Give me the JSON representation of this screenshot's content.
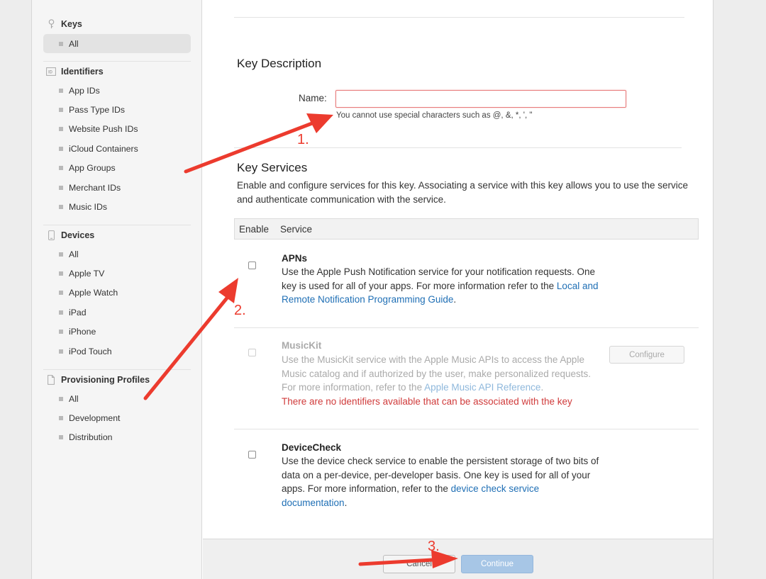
{
  "sidebar": {
    "sections": [
      {
        "icon": "key-icon",
        "title": "Keys",
        "items": [
          {
            "label": "All",
            "selected": true
          }
        ]
      },
      {
        "icon": "id-icon",
        "title": "Identifiers",
        "items": [
          {
            "label": "App IDs"
          },
          {
            "label": "Pass Type IDs"
          },
          {
            "label": "Website Push IDs"
          },
          {
            "label": "iCloud Containers"
          },
          {
            "label": "App Groups"
          },
          {
            "label": "Merchant IDs"
          },
          {
            "label": "Music IDs"
          }
        ]
      },
      {
        "icon": "device-icon",
        "title": "Devices",
        "items": [
          {
            "label": "All"
          },
          {
            "label": "Apple TV"
          },
          {
            "label": "Apple Watch"
          },
          {
            "label": "iPad"
          },
          {
            "label": "iPhone"
          },
          {
            "label": "iPod Touch"
          }
        ]
      },
      {
        "icon": "document-icon",
        "title": "Provisioning Profiles",
        "items": [
          {
            "label": "All"
          },
          {
            "label": "Development"
          },
          {
            "label": "Distribution"
          }
        ]
      }
    ]
  },
  "key_description": {
    "heading": "Key Description",
    "name_label": "Name:",
    "name_value": "",
    "name_hint": "You cannot use special characters such as @, &, *, ', \""
  },
  "key_services": {
    "heading": "Key Services",
    "intro": "Enable and configure services for this key. Associating a service with this key allows you to use the service and authenticate communication with the service.",
    "col_enable": "Enable",
    "col_service": "Service",
    "services": [
      {
        "title": "APNs",
        "desc": "Use the Apple Push Notification service for your notification requests. One key is used for all of your apps. For more information refer to the ",
        "link": "Local and Remote Notification Programming Guide",
        "suffix": "."
      },
      {
        "title": "MusicKit",
        "desc": "Use the MusicKit service with the Apple Music APIs to access the Apple Music catalog and if authorized by the user, make personalized requests. For more information, refer to the ",
        "link": "Apple Music API Reference",
        "suffix": ".",
        "warning": "There are no identifiers available that can be associated with the key",
        "configure_label": "Configure"
      },
      {
        "title": "DeviceCheck",
        "desc": "Use the device check service to enable the persistent storage of two bits of data on a per-device, per-developer basis. One key is used for all of your apps. For more information, refer to the ",
        "link": "device check service documentation",
        "suffix": "."
      }
    ]
  },
  "footer": {
    "cancel_label": "Cancel",
    "continue_label": "Continue"
  },
  "annotations": {
    "step1": "1.",
    "step2": "2.",
    "step3": "3.",
    "arrow_color": "#ec3b2e"
  }
}
